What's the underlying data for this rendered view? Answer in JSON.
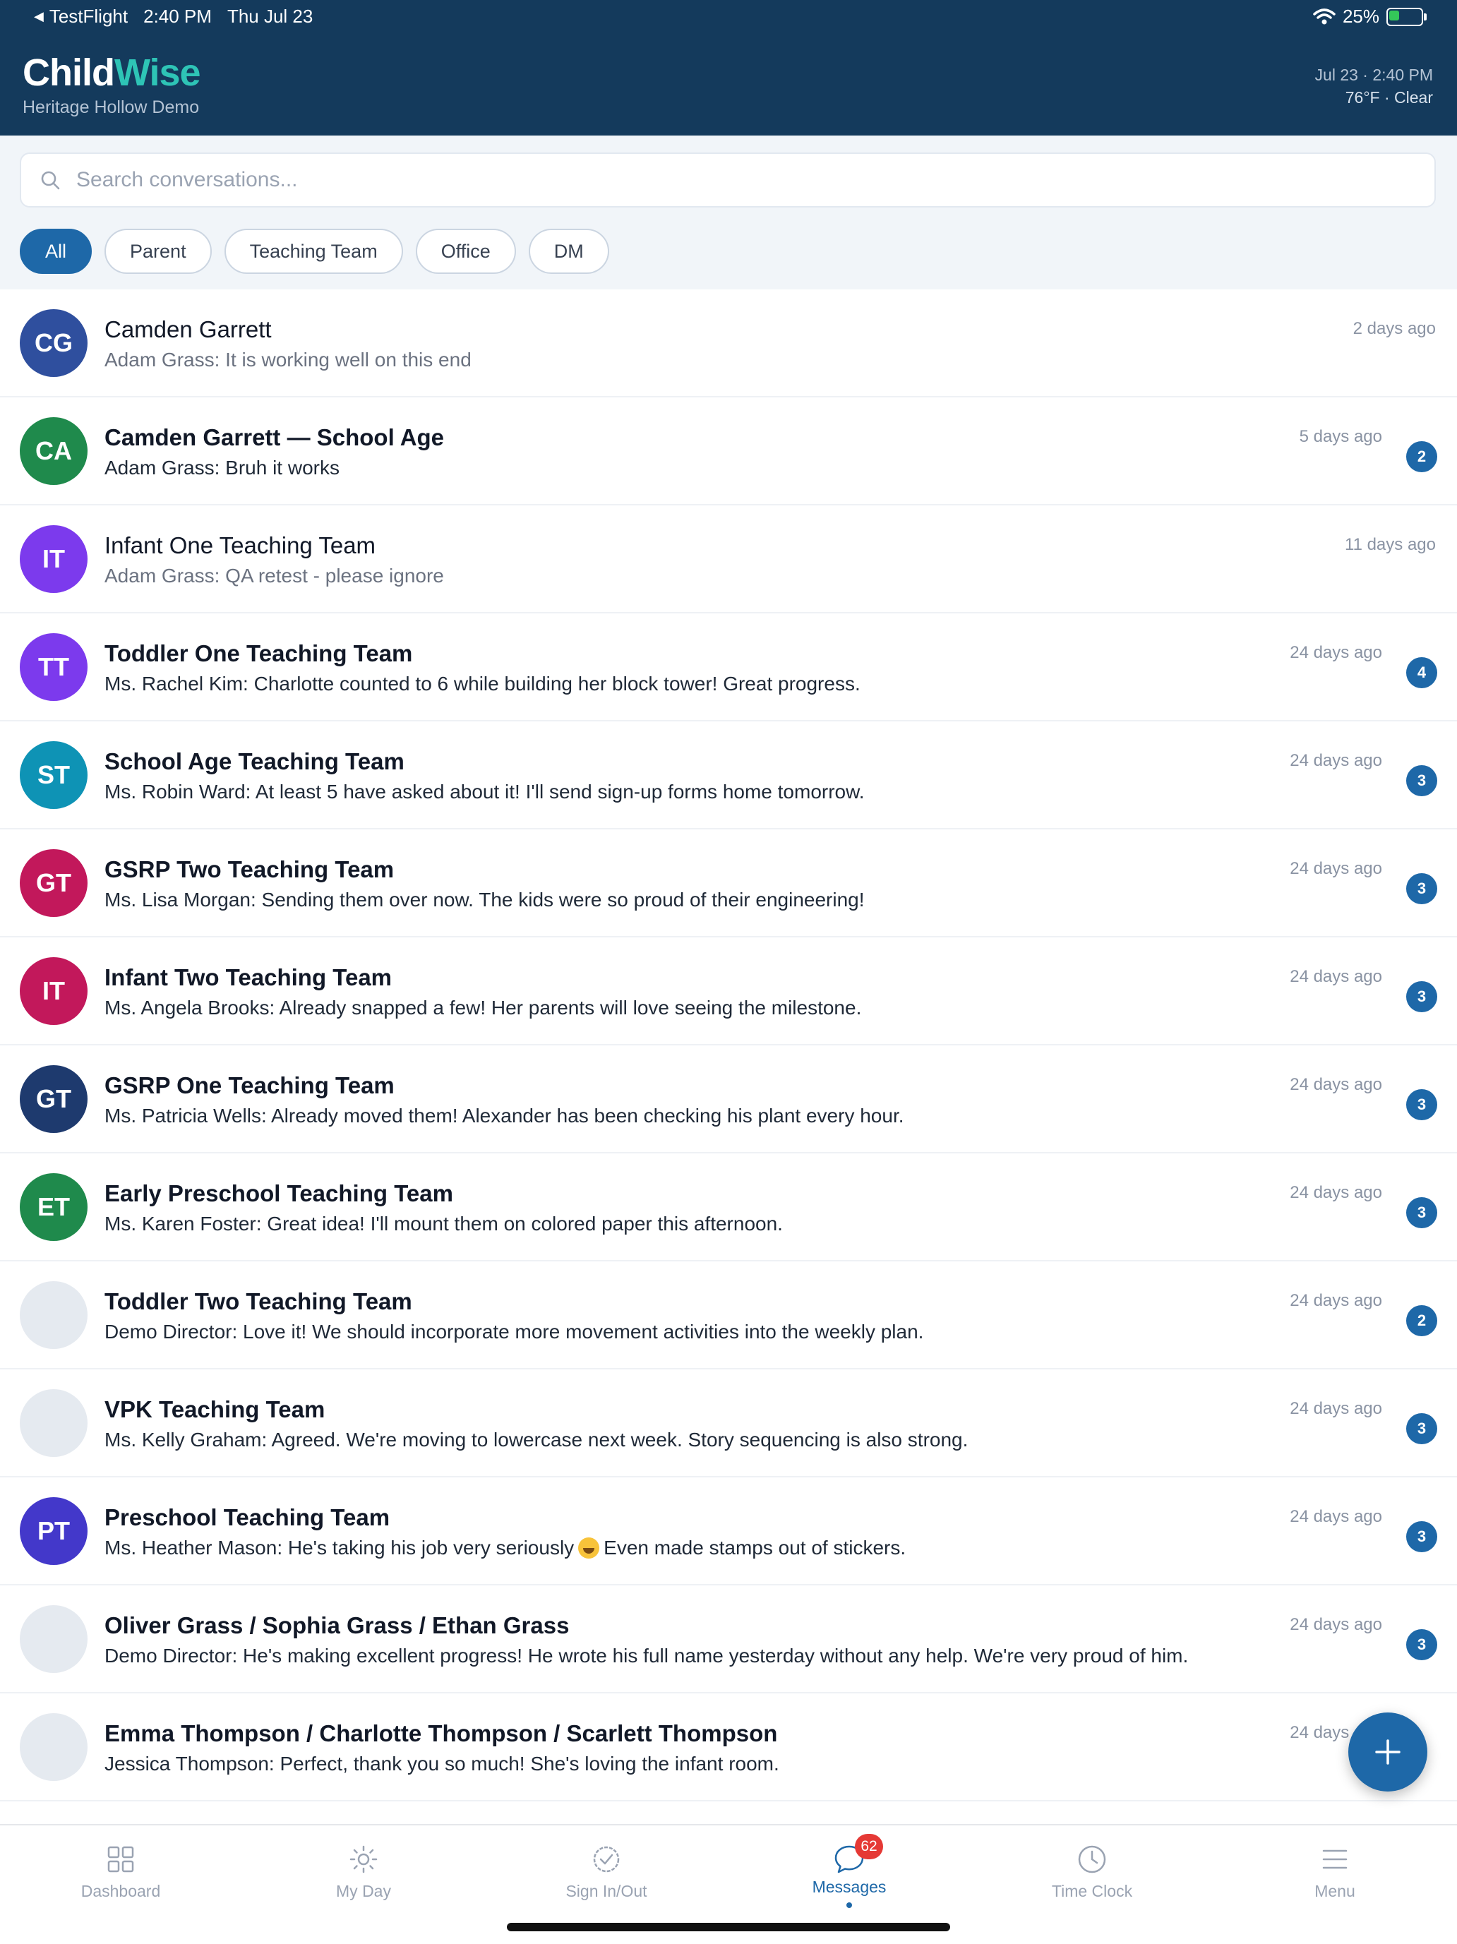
{
  "status_bar": {
    "back_app": "TestFlight",
    "time": "2:40 PM",
    "date": "Thu Jul 23",
    "battery": "25%"
  },
  "header": {
    "brand_part1": "Child",
    "brand_part2": "Wise",
    "subtitle": "Heritage Hollow Demo",
    "datetime": "Jul 23 · 2:40 PM",
    "weather": "76°F · Clear"
  },
  "search": {
    "placeholder": "Search conversations..."
  },
  "filters": [
    "All",
    "Parent",
    "Teaching Team",
    "Office",
    "DM"
  ],
  "conversations": [
    {
      "initials": "CG",
      "avatar_color": "#2f4f9e",
      "name": "Camden Garrett",
      "preview": "Adam Grass: It is working well on this end",
      "time": "2 days ago",
      "unread": false,
      "badge": ""
    },
    {
      "initials": "CA",
      "avatar_color": "#1f8a4c",
      "name": "Camden Garrett — School Age",
      "preview": "Adam Grass: Bruh it works",
      "time": "5 days ago",
      "unread": true,
      "badge": "2"
    },
    {
      "initials": "IT",
      "avatar_color": "#7c3aed",
      "name": "Infant One Teaching Team",
      "preview": "Adam Grass: QA retest - please ignore",
      "time": "11 days ago",
      "unread": false,
      "badge": ""
    },
    {
      "initials": "TT",
      "avatar_color": "#7c3aed",
      "name": "Toddler One Teaching Team",
      "preview": "Ms. Rachel Kim: Charlotte counted to 6 while building her block tower! Great progress.",
      "time": "24 days ago",
      "unread": true,
      "badge": "4"
    },
    {
      "initials": "ST",
      "avatar_color": "#0e93b5",
      "name": "School Age Teaching Team",
      "preview": "Ms. Robin Ward: At least 5 have asked about it! I'll send sign-up forms home tomorrow.",
      "time": "24 days ago",
      "unread": true,
      "badge": "3"
    },
    {
      "initials": "GT",
      "avatar_color": "#c2185b",
      "name": "GSRP Two Teaching Team",
      "preview": "Ms. Lisa Morgan: Sending them over now. The kids were so proud of their engineering!",
      "time": "24 days ago",
      "unread": true,
      "badge": "3"
    },
    {
      "initials": "IT",
      "avatar_color": "#c2185b",
      "name": "Infant Two Teaching Team",
      "preview": "Ms. Angela Brooks: Already snapped a few! Her parents will love seeing the milestone.",
      "time": "24 days ago",
      "unread": true,
      "badge": "3"
    },
    {
      "initials": "GT",
      "avatar_color": "#1e3a6e",
      "name": "GSRP One Teaching Team",
      "preview": "Ms. Patricia Wells: Already moved them! Alexander has been checking his plant every hour.",
      "time": "24 days ago",
      "unread": true,
      "badge": "3"
    },
    {
      "initials": "ET",
      "avatar_color": "#1f8a4c",
      "name": "Early Preschool Teaching Team",
      "preview": "Ms. Karen Foster: Great idea! I'll mount them on colored paper this afternoon.",
      "time": "24 days ago",
      "unread": true,
      "badge": "3"
    },
    {
      "initials": "",
      "avatar_color": "#e5eaf0",
      "name": "Toddler Two Teaching Team",
      "preview": "Demo Director: Love it! We should incorporate more movement activities into the weekly plan.",
      "time": "24 days ago",
      "unread": true,
      "badge": "2"
    },
    {
      "initials": "",
      "avatar_color": "#e5eaf0",
      "name": "VPK Teaching Team",
      "preview": "Ms. Kelly Graham: Agreed. We're moving to lowercase next week. Story sequencing is also strong.",
      "time": "24 days ago",
      "unread": true,
      "badge": "3"
    },
    {
      "initials": "PT",
      "avatar_color": "#4338ca",
      "name": "Preschool Teaching Team",
      "preview": "Ms. Heather Mason: He's taking his job very seriously",
      "preview_after_emoji": "Even made stamps out of stickers.",
      "has_emoji": true,
      "time": "24 days ago",
      "unread": true,
      "badge": "3"
    },
    {
      "initials": "",
      "avatar_color": "#e5eaf0",
      "name": "Oliver Grass / Sophia Grass / Ethan Grass",
      "preview": "Demo Director: He's making excellent progress! He wrote his full name yesterday without any help. We're very proud of him.",
      "time": "24 days ago",
      "unread": true,
      "badge": "3"
    },
    {
      "initials": "",
      "avatar_color": "#e5eaf0",
      "name": "Emma Thompson / Charlotte Thompson / Scarlett Thompson",
      "preview": "Jessica Thompson: Perfect, thank you so much! She's loving the infant room.",
      "time": "24 days ago",
      "unread": true,
      "badge": ""
    }
  ],
  "tabs": [
    {
      "label": "Dashboard",
      "icon": "dashboard-icon"
    },
    {
      "label": "My Day",
      "icon": "sun-icon"
    },
    {
      "label": "Sign In/Out",
      "icon": "check-badge-icon"
    },
    {
      "label": "Messages",
      "icon": "chat-bubble-icon",
      "badge": "62",
      "active": true
    },
    {
      "label": "Time Clock",
      "icon": "clock-icon"
    },
    {
      "label": "Menu",
      "icon": "hamburger-menu-icon"
    }
  ],
  "colors": {
    "header_bg": "#143a5c",
    "accent": "#1e68a8",
    "brand_accent": "#2ec4b6",
    "notification": "#e53935"
  }
}
